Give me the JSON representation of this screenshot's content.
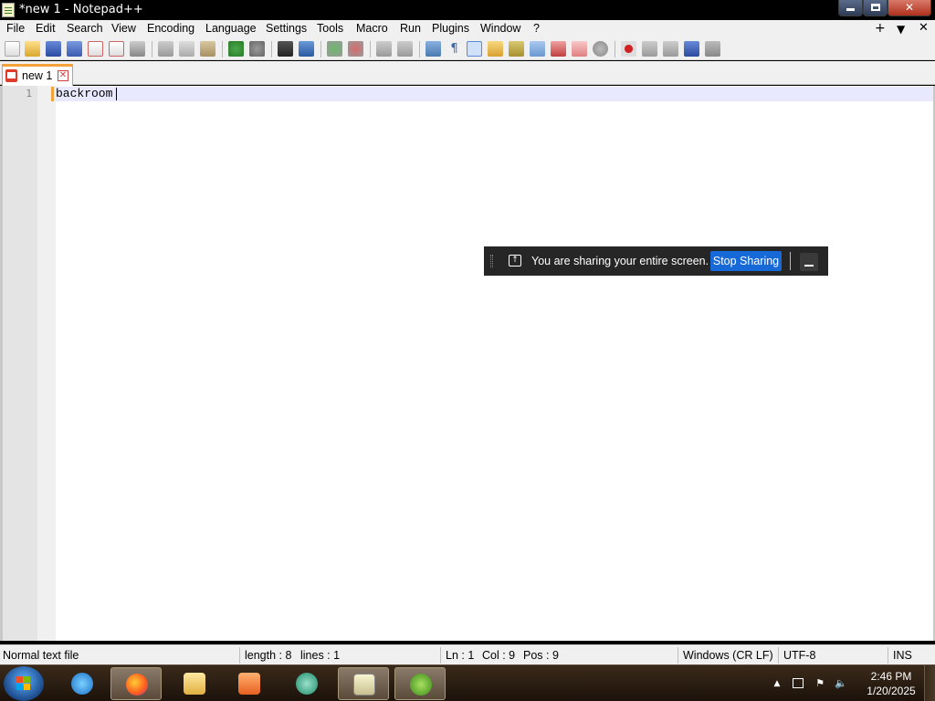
{
  "window": {
    "title": "*new 1 - Notepad++",
    "close_glyph": "✕"
  },
  "menu": {
    "items": [
      "File",
      "Edit",
      "Search",
      "View",
      "Encoding",
      "Language",
      "Settings",
      "Tools",
      "Macro",
      "Run",
      "Plugins",
      "Window",
      "?"
    ],
    "right": [
      "+",
      "▼",
      "✕"
    ]
  },
  "toolbar": {
    "icons": [
      "new-file-icon",
      "open-file-icon",
      "save-icon",
      "save-all-icon",
      "close-icon",
      "close-all-icon",
      "print-icon",
      "cut-icon",
      "copy-icon",
      "paste-icon",
      "undo-icon",
      "redo-icon",
      "find-icon",
      "replace-icon",
      "zoom-in-icon",
      "zoom-out-icon",
      "sync-vertical-icon",
      "sync-horizontal-icon",
      "word-wrap-icon",
      "show-all-characters-icon",
      "indent-guide-icon",
      "user-defined-language-icon",
      "document-map-icon",
      "document-list-icon",
      "function-list-icon",
      "folder-as-workspace-icon",
      "monitoring-icon",
      "record-macro-icon",
      "stop-recording-icon",
      "playback-icon",
      "run-macro-multiple-icon",
      "save-macro-icon"
    ]
  },
  "tabs": [
    {
      "label": "new 1",
      "close_glyph": "✕"
    }
  ],
  "editor": {
    "line_number": "1",
    "text": "backroom"
  },
  "share_bar": {
    "message": "You are sharing your entire screen.",
    "stop_label": "Stop Sharing",
    "share_glyph": "↑"
  },
  "status": {
    "file_type": "Normal text file",
    "length": "length : 8",
    "lines": "lines : 1",
    "ln": "Ln : 1",
    "col": "Col : 9",
    "pos": "Pos : 9",
    "eol": "Windows (CR LF)",
    "encoding": "UTF-8",
    "mode": "INS"
  },
  "taskbar": {
    "apps": [
      "internet-explorer-icon",
      "firefox-icon",
      "file-explorer-icon",
      "media-player-icon",
      "browser-icon",
      "notepadpp-icon",
      "notepadpp-plugin-icon"
    ],
    "tray": {
      "arrow_glyph": "▲",
      "time": "2:46 PM",
      "date": "1/20/2025"
    }
  },
  "colors": {
    "accent_orange": "#f6a23a",
    "stop_sharing_blue": "#1769d8",
    "taskbar_brown": "#2a1c10"
  }
}
